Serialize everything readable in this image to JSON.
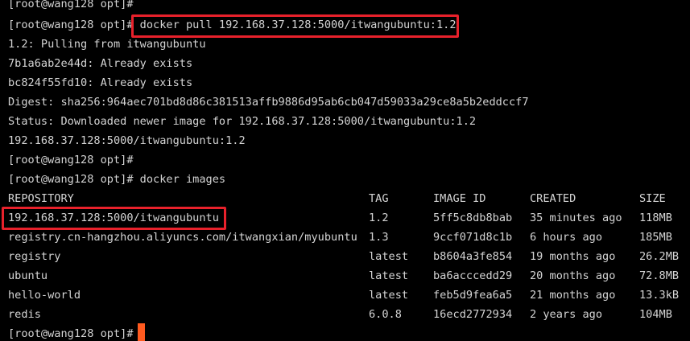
{
  "terminal": {
    "lines": [
      "[root@wang128 opt]#",
      "[root@wang128 opt]# docker pull 192.168.37.128:5000/itwangubuntu:1.2",
      "1.2: Pulling from itwangubuntu",
      "7b1a6ab2e44d: Already exists",
      "bc824f55fd10: Already exists",
      "Digest: sha256:964aec701bd8d86c381513affb9886d95ab6cb047d59033a29ce8a5b2eddccf7",
      "Status: Downloaded newer image for 192.168.37.128:5000/itwangubuntu:1.2",
      "192.168.37.128:5000/itwangubuntu:1.2",
      "[root@wang128 opt]#",
      "[root@wang128 opt]# docker images"
    ],
    "table": {
      "headers": [
        "REPOSITORY",
        "TAG",
        "IMAGE ID",
        "CREATED",
        "SIZE"
      ],
      "rows": [
        [
          "192.168.37.128:5000/itwangubuntu",
          "1.2",
          "5ff5c8db8bab",
          "35 minutes ago",
          "118MB"
        ],
        [
          "registry.cn-hangzhou.aliyuncs.com/itwangxian/myubuntu",
          "1.3",
          "9ccf071d8c1b",
          "6 hours ago",
          "185MB"
        ],
        [
          "registry",
          "latest",
          "b8604a3fe854",
          "19 months ago",
          "26.2MB"
        ],
        [
          "ubuntu",
          "latest",
          "ba6acccedd29",
          "20 months ago",
          "72.8MB"
        ],
        [
          "hello-world",
          "latest",
          "feb5d9fea6a5",
          "21 months ago",
          "13.3kB"
        ],
        [
          "redis",
          "6.0.8",
          "16ecd2772934",
          "2 years ago",
          "104MB"
        ]
      ]
    },
    "prompt": "[root@wang128 opt]#",
    "colors": {
      "background": "#000000",
      "text": "#d4d4d4",
      "highlight": "#e8212b",
      "cursor": "#ff5a1f"
    }
  }
}
